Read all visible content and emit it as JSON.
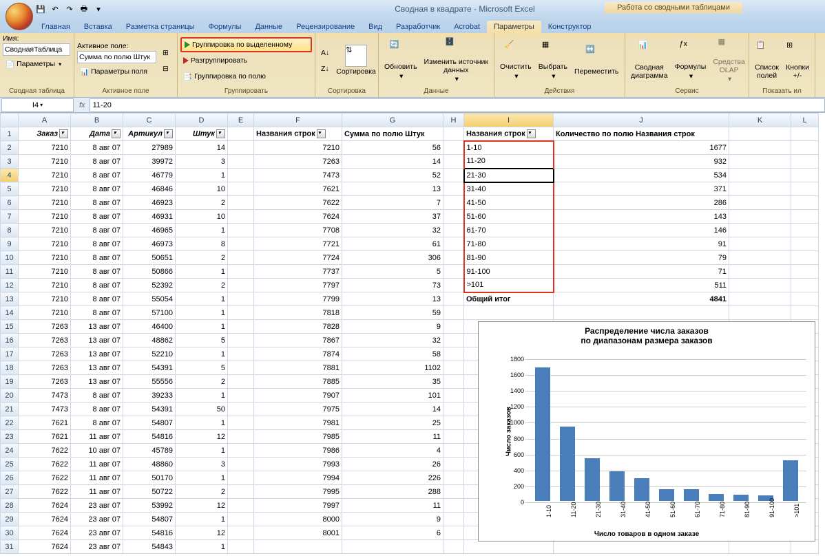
{
  "title": "Сводная в квадрате - Microsoft Excel",
  "ctx_tab_title": "Работа со сводными таблицами",
  "tabs": [
    "Главная",
    "Вставка",
    "Разметка страницы",
    "Формулы",
    "Данные",
    "Рецензирование",
    "Вид",
    "Разработчик",
    "Acrobat",
    "Параметры",
    "Конструктор"
  ],
  "active_tab": 9,
  "ribbon": {
    "name_label": "Имя:",
    "name_val": "СводнаяТаблица",
    "params_btn": "Параметры",
    "pt_group": "Сводная таблица",
    "active_field_label": "Активное поле:",
    "active_field_val": "Сумма по полю Штук",
    "field_params": "Параметры поля",
    "active_field_group": "Активное поле",
    "group_sel": "Группировка по выделенному",
    "ungroup": "Разгруппировать",
    "group_field": "Группировка по полю",
    "group_group": "Группировать",
    "sort": "Сортировка",
    "sort_group": "Сортировка",
    "refresh": "Обновить",
    "change_src": "Изменить источник данных",
    "data_group": "Данные",
    "clear": "Очистить",
    "select": "Выбрать",
    "move": "Переместить",
    "actions_group": "Действия",
    "pivot_chart": "Сводная диаграмма",
    "formulas": "Формулы",
    "olap": "Средства OLAP",
    "service_group": "Сервис",
    "field_list": "Список полей",
    "buttons": "Кнопки +/-",
    "show_group": "Показать ил"
  },
  "name_box": "I4",
  "formula": "11-20",
  "columns": [
    "A",
    "B",
    "C",
    "D",
    "E",
    "F",
    "G",
    "H",
    "I",
    "J",
    "K",
    "L"
  ],
  "headers": {
    "A": "Заказ",
    "B": "Дата",
    "C": "Артикул",
    "D": "Штук",
    "F": "Названия строк",
    "G": "Сумма по полю Штук",
    "I": "Названия строк",
    "J": "Количество по полю Названия строк"
  },
  "rows": [
    {
      "r": 2,
      "A": 7210,
      "B": "8 авг 07",
      "C": 27989,
      "D": 14,
      "F": 7210,
      "G": 56,
      "I": "1-10",
      "J": 1677
    },
    {
      "r": 3,
      "A": 7210,
      "B": "8 авг 07",
      "C": 39972,
      "D": 3,
      "F": 7263,
      "G": 14,
      "I": "11-20",
      "J": 932
    },
    {
      "r": 4,
      "A": 7210,
      "B": "8 авг 07",
      "C": 46779,
      "D": 1,
      "F": 7473,
      "G": 52,
      "I": "21-30",
      "J": 534
    },
    {
      "r": 5,
      "A": 7210,
      "B": "8 авг 07",
      "C": 46846,
      "D": 10,
      "F": 7621,
      "G": 13,
      "I": "31-40",
      "J": 371
    },
    {
      "r": 6,
      "A": 7210,
      "B": "8 авг 07",
      "C": 46923,
      "D": 2,
      "F": 7622,
      "G": 7,
      "I": "41-50",
      "J": 286
    },
    {
      "r": 7,
      "A": 7210,
      "B": "8 авг 07",
      "C": 46931,
      "D": 10,
      "F": 7624,
      "G": 37,
      "I": "51-60",
      "J": 143
    },
    {
      "r": 8,
      "A": 7210,
      "B": "8 авг 07",
      "C": 46965,
      "D": 1,
      "F": 7708,
      "G": 32,
      "I": "61-70",
      "J": 146
    },
    {
      "r": 9,
      "A": 7210,
      "B": "8 авг 07",
      "C": 46973,
      "D": 8,
      "F": 7721,
      "G": 61,
      "I": "71-80",
      "J": 91
    },
    {
      "r": 10,
      "A": 7210,
      "B": "8 авг 07",
      "C": 50651,
      "D": 2,
      "F": 7724,
      "G": 306,
      "I": "81-90",
      "J": 79
    },
    {
      "r": 11,
      "A": 7210,
      "B": "8 авг 07",
      "C": 50866,
      "D": 1,
      "F": 7737,
      "G": 5,
      "I": "91-100",
      "J": 71
    },
    {
      "r": 12,
      "A": 7210,
      "B": "8 авг 07",
      "C": 52392,
      "D": 2,
      "F": 7797,
      "G": 73,
      "I": ">101",
      "J": 511
    },
    {
      "r": 13,
      "A": 7210,
      "B": "8 авг 07",
      "C": 55054,
      "D": 1,
      "F": 7799,
      "G": 13,
      "I": "Общий итог",
      "J": 4841,
      "total": true
    },
    {
      "r": 14,
      "A": 7210,
      "B": "8 авг 07",
      "C": 57100,
      "D": 1,
      "F": 7818,
      "G": 59
    },
    {
      "r": 15,
      "A": 7263,
      "B": "13 авг 07",
      "C": 46400,
      "D": 1,
      "F": 7828,
      "G": 9
    },
    {
      "r": 16,
      "A": 7263,
      "B": "13 авг 07",
      "C": 48862,
      "D": 5,
      "F": 7867,
      "G": 32
    },
    {
      "r": 17,
      "A": 7263,
      "B": "13 авг 07",
      "C": 52210,
      "D": 1,
      "F": 7874,
      "G": 58
    },
    {
      "r": 18,
      "A": 7263,
      "B": "13 авг 07",
      "C": 54391,
      "D": 5,
      "F": 7881,
      "G": 1102
    },
    {
      "r": 19,
      "A": 7263,
      "B": "13 авг 07",
      "C": 55556,
      "D": 2,
      "F": 7885,
      "G": 35
    },
    {
      "r": 20,
      "A": 7473,
      "B": "8 авг 07",
      "C": 39233,
      "D": 1,
      "F": 7907,
      "G": 101
    },
    {
      "r": 21,
      "A": 7473,
      "B": "8 авг 07",
      "C": 54391,
      "D": 50,
      "F": 7975,
      "G": 14
    },
    {
      "r": 22,
      "A": 7621,
      "B": "8 авг 07",
      "C": 54807,
      "D": 1,
      "F": 7981,
      "G": 25
    },
    {
      "r": 23,
      "A": 7621,
      "B": "11 авг 07",
      "C": 54816,
      "D": 12,
      "F": 7985,
      "G": 11
    },
    {
      "r": 24,
      "A": 7622,
      "B": "10 авг 07",
      "C": 45789,
      "D": 1,
      "F": 7986,
      "G": 4
    },
    {
      "r": 25,
      "A": 7622,
      "B": "11 авг 07",
      "C": 48860,
      "D": 3,
      "F": 7993,
      "G": 26
    },
    {
      "r": 26,
      "A": 7622,
      "B": "11 авг 07",
      "C": 50170,
      "D": 1,
      "F": 7994,
      "G": 226
    },
    {
      "r": 27,
      "A": 7622,
      "B": "11 авг 07",
      "C": 50722,
      "D": 2,
      "F": 7995,
      "G": 288
    },
    {
      "r": 28,
      "A": 7624,
      "B": "23 авг 07",
      "C": 53992,
      "D": 12,
      "F": 7997,
      "G": 11
    },
    {
      "r": 29,
      "A": 7624,
      "B": "23 авг 07",
      "C": 54807,
      "D": 1,
      "F": 8000,
      "G": 9
    },
    {
      "r": 30,
      "A": 7624,
      "B": "23 авг 07",
      "C": 54816,
      "D": 12,
      "F": 8001,
      "G": 6
    },
    {
      "r": 31,
      "A": 7624,
      "B": "23 авг 07",
      "C": 54843,
      "D": 1
    }
  ],
  "chart_data": {
    "type": "bar",
    "title": "Распределение числа заказов",
    "subtitle": "по диапазонам размера заказов",
    "categories": [
      "1-10",
      "11-20",
      "21-30",
      "31-40",
      "41-50",
      "51-60",
      "61-70",
      "71-80",
      "81-90",
      "91-100",
      ">101"
    ],
    "values": [
      1677,
      932,
      534,
      371,
      286,
      143,
      146,
      91,
      79,
      71,
      511
    ],
    "ylabel": "Число заказов",
    "xlabel": "Число товаров в одном заказе",
    "ylim": [
      0,
      1800
    ],
    "yticks": [
      0,
      200,
      400,
      600,
      800,
      1000,
      1200,
      1400,
      1600,
      1800
    ]
  }
}
